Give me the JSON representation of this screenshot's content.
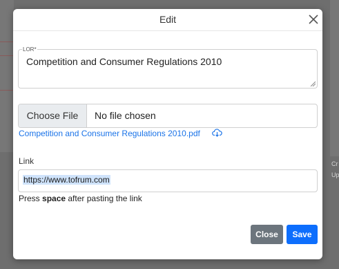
{
  "background": {
    "right_text_1": "Cr",
    "right_text_2": "Up"
  },
  "modal": {
    "title": "Edit"
  },
  "lor": {
    "label": "LOR*",
    "value": "Competition and Consumer Regulations 2010"
  },
  "file": {
    "button_label": "Choose File",
    "status": "No file chosen",
    "existing_file": "Competition and Consumer Regulations 2010.pdf"
  },
  "link": {
    "label": "Link",
    "value": "https://www.tofrum.com",
    "hint_prefix": "Press ",
    "hint_key": "space",
    "hint_suffix": " after pasting the link"
  },
  "footer": {
    "close_label": "Close",
    "save_label": "Save"
  },
  "colors": {
    "primary": "#0d6efd",
    "secondary": "#6c757d",
    "link": "#1a73e8"
  }
}
